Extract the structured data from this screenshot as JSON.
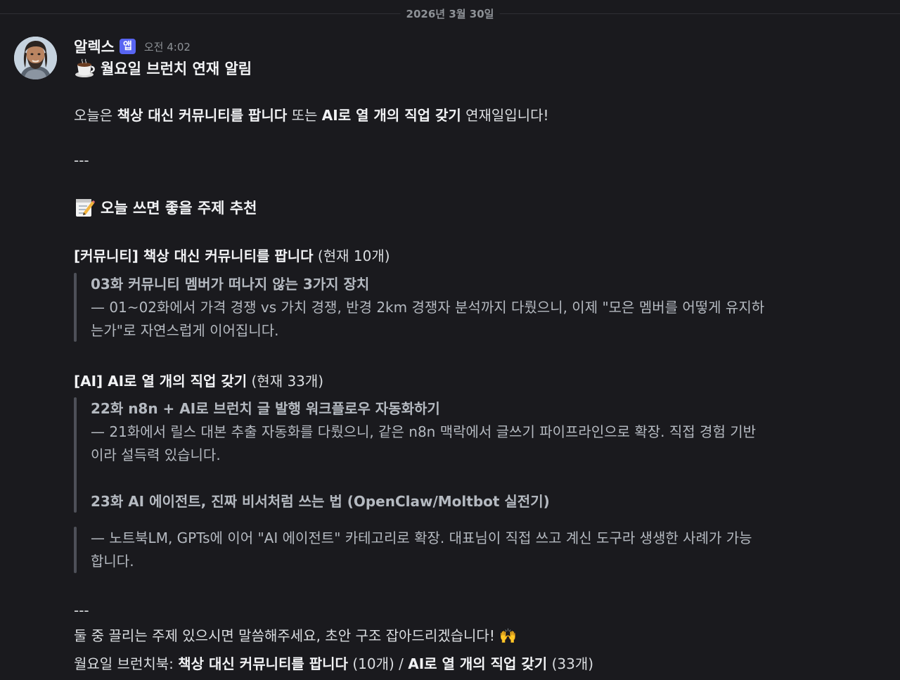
{
  "divider": {
    "date": "2026년 3월 30일"
  },
  "message": {
    "author": "알렉스",
    "badge": "앱",
    "time": "오전 4:02",
    "title": "월요일 브런치 연재 알림",
    "intro": {
      "prefix": "오늘은 ",
      "series1": "책상 대신 커뮤니티를 팝니다",
      "middle": " 또는 ",
      "series2": "AI로 열 개의 직업 갖기",
      "suffix": " 연재일입니다!"
    },
    "separator1": "---",
    "topics_heading": "오늘 쓰면 좋을 주제 추천",
    "section1": {
      "label": "[커뮤니티] 책상 대신 커뮤니티를 팝니다",
      "count": " (현재 10개)",
      "quote_title": "03화 커뮤니티 멤버가 떠나지 않는 3가지 장치",
      "quote_line1": "— 01~02화에서 가격 경쟁 vs 가치 경쟁, 반경 2km 경쟁자 분석까지 다뤘으니, 이제 \"모은 멤버를 어떻게 유지하",
      "quote_line2": "는가\"로 자연스럽게 이어집니다."
    },
    "section2": {
      "label": "[AI] AI로 열 개의 직업 갖기",
      "count": " (현재 33개)",
      "quote1_title": "22화 n8n + AI로 브런치 글 발행 워크플로우 자동화하기",
      "quote1_line1": "— 21화에서 릴스 대본 추출 자동화를 다뤘으니, 같은 n8n 맥락에서 글쓰기 파이프라인으로 확장. 직접 경험 기반",
      "quote1_line2": "이라 설득력 있습니다.",
      "quote1_title2": "23화 AI 에이전트, 진짜 비서처럼 쓰는 법 (OpenClaw/Moltbot 실전기)",
      "quote2_line1": "— 노트북LM, GPTs에 이어 \"AI 에이전트\" 카테고리로 확장. 대표님이 직접 쓰고 계신 도구라 생생한 사례가 가능",
      "quote2_line2": "합니다."
    },
    "separator2": "---",
    "closing": "둘 중 끌리는 주제 있으시면 말씀해주세요, 초안 구조 잡아드리겠습니다! 🙌",
    "footer": {
      "prefix": "월요일 브런치북: ",
      "book1": "책상 대신 커뮤니티를 팝니다",
      "count1": " (10개) / ",
      "book2": "AI로 열 개의 직업 갖기",
      "count2": " (33개)"
    }
  },
  "icons": {
    "title_emoji": "coffee-icon",
    "topics_emoji": "memo-icon"
  }
}
